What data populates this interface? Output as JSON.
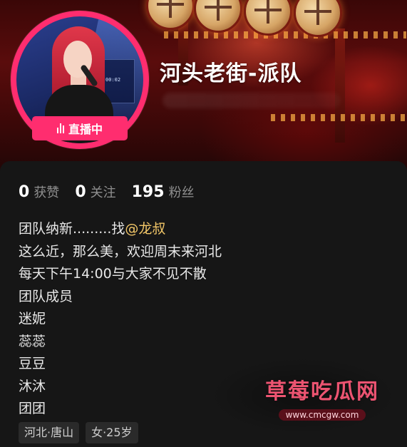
{
  "profile": {
    "nickname": "河头老街-派队",
    "live_badge_label": "直播中",
    "stats": [
      {
        "value": "0",
        "label": "获赞"
      },
      {
        "value": "0",
        "label": "关注"
      },
      {
        "value": "195",
        "label": "粉丝"
      }
    ],
    "bio": {
      "line1_prefix": "团队纳新.........找",
      "line1_mention": "@龙叔",
      "lines": [
        "这么近，那么美，欢迎周末来河北",
        "每天下午14:00与大家不见不散",
        "团队成员",
        "迷妮",
        "蕊蕊",
        "豆豆",
        "沐沐",
        "团团"
      ]
    },
    "tags": [
      "河北·唐山",
      "女·25岁"
    ]
  },
  "avatar_overlay": {
    "screen_time": "00:02"
  },
  "watermark": {
    "title": "草莓吃瓜网",
    "url": "www.cmcgw.com"
  },
  "colors": {
    "accent_pink": "#ff2d6f",
    "mention_gold": "#f3c768",
    "background": "#161616",
    "banner_red": "#5a0c0c"
  },
  "icons": {
    "live": "live-bars-icon"
  }
}
